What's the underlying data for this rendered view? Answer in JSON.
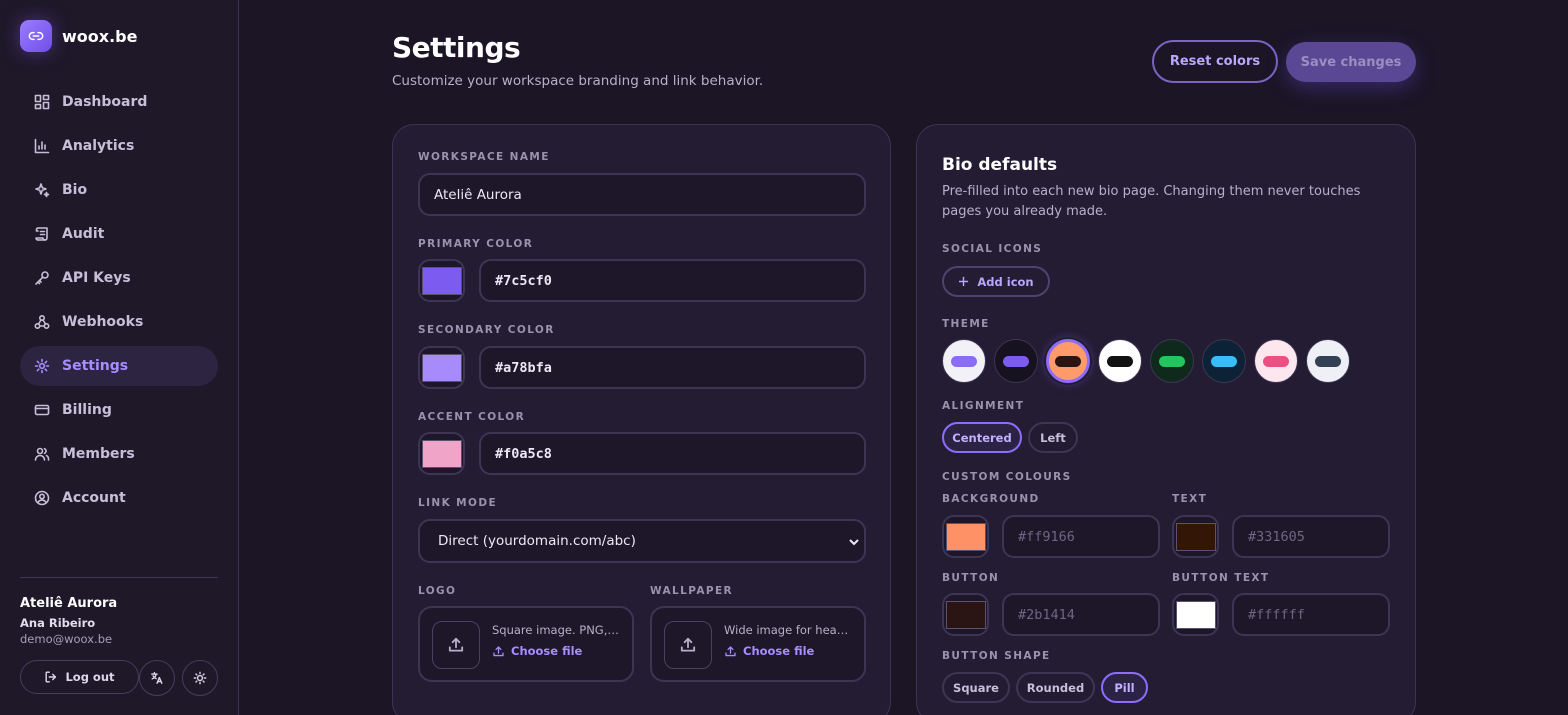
{
  "brand": {
    "name": "woox.be"
  },
  "nav": [
    {
      "label": "Dashboard"
    },
    {
      "label": "Analytics"
    },
    {
      "label": "Bio"
    },
    {
      "label": "Audit"
    },
    {
      "label": "API Keys"
    },
    {
      "label": "Webhooks"
    },
    {
      "label": "Settings",
      "active": true
    },
    {
      "label": "Billing"
    },
    {
      "label": "Members"
    },
    {
      "label": "Account"
    }
  ],
  "user": {
    "org": "Ateliê Aurora",
    "name": "Ana Ribeiro",
    "email": "demo@woox.be",
    "logout_label": "Log out"
  },
  "header": {
    "title": "Settings",
    "subtitle": "Customize your workspace branding and link behavior.",
    "reset_label": "Reset colors",
    "save_label": "Save changes"
  },
  "workspace": {
    "name_label": "WORKSPACE NAME",
    "name_value": "Ateliê Aurora",
    "primary_label": "PRIMARY COLOR",
    "primary_value": "#7c5cf0",
    "secondary_label": "SECONDARY COLOR",
    "secondary_value": "#a78bfa",
    "accent_label": "ACCENT COLOR",
    "accent_value": "#f0a5c8",
    "link_mode_label": "LINK MODE",
    "link_mode_value": "Direct (yourdomain.com/abc)",
    "logo_label": "LOGO",
    "logo_desc": "Square image. PNG, JPG or SVG.",
    "logo_choose": "Choose file",
    "wallpaper_label": "WALLPAPER",
    "wallpaper_desc": "Wide image for header background.",
    "wallpaper_choose": "Choose file"
  },
  "bio": {
    "title": "Bio defaults",
    "description": "Pre-filled into each new bio page. Changing them never touches pages you already made.",
    "social_label": "SOCIAL ICONS",
    "add_icon_label": "Add icon",
    "theme_label": "THEME",
    "themes": [
      {
        "bg": "#f3f1f8",
        "pill": "#8b6cf5"
      },
      {
        "bg": "#16121f",
        "pill": "#7c5cf0"
      },
      {
        "bg": "#ff9a6a",
        "pill": "#2b1414",
        "selected": true
      },
      {
        "bg": "#ffffff",
        "pill": "#111111"
      },
      {
        "bg": "#0f2a1c",
        "pill": "#22c55e"
      },
      {
        "bg": "#0d2236",
        "pill": "#38bdf8"
      },
      {
        "bg": "#fde7ef",
        "pill": "#ec4f82"
      },
      {
        "bg": "#eef0f5",
        "pill": "#334155"
      }
    ],
    "alignment_label": "ALIGNMENT",
    "alignment_options": [
      "Centered",
      "Left"
    ],
    "alignment_selected": "Centered",
    "custom_colours_label": "CUSTOM COLOURS",
    "background_label": "BACKGROUND",
    "background_placeholder": "#ff9166",
    "background_swatch": "#ff9166",
    "text_label": "TEXT",
    "text_placeholder": "#331605",
    "text_swatch": "#331605",
    "button_label": "BUTTON",
    "button_placeholder": "#2b1414",
    "button_swatch": "#2b1414",
    "button_text_label": "BUTTON TEXT",
    "button_text_placeholder": "#ffffff",
    "button_text_swatch": "#ffffff",
    "button_shape_label": "BUTTON SHAPE",
    "shape_options": [
      "Square",
      "Rounded",
      "Pill"
    ],
    "shape_selected": "Pill"
  },
  "colors": {
    "accent": "#7c5cf0",
    "background": "#1b1526"
  }
}
